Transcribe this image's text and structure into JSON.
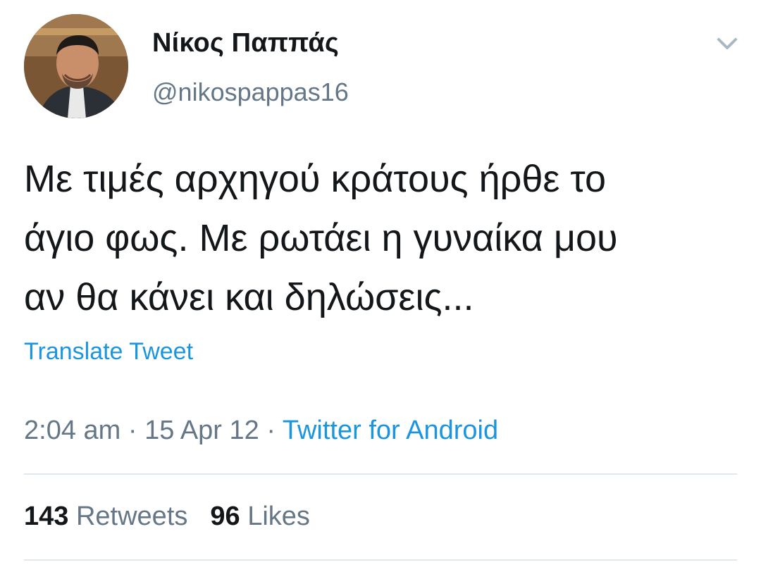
{
  "author": {
    "display_name": "Νίκος Παππάς",
    "username": "@nikospappas16",
    "avatar_icon": "profile-photo"
  },
  "tweet": {
    "text": "Με τιμές αρχηγού κράτους ήρθε το\nάγιο φως. Με ρωτάει η γυναίκα μου\nαν θα κάνει και δηλώσεις...",
    "translate_label": "Translate Tweet",
    "time": "2:04 am",
    "date": "15 Apr 12",
    "source": "Twitter for Android",
    "separator": " · "
  },
  "stats": {
    "retweets_count": "143",
    "retweets_label": "Retweets",
    "likes_count": "96",
    "likes_label": "Likes"
  },
  "colors": {
    "link": "#1b95e0",
    "secondary_text": "#657786",
    "primary_text": "#14171a",
    "divider": "#e1e8ed"
  }
}
